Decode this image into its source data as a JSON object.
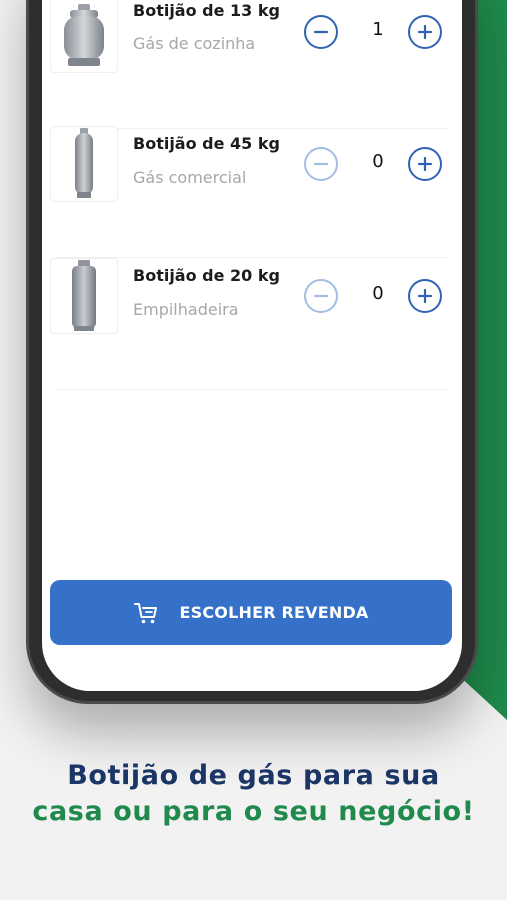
{
  "colors": {
    "brand_blue": "#3571c8",
    "brand_green": "#1f8a4c",
    "headline_navy": "#1c3567"
  },
  "products": [
    {
      "name": "Botijão de 13 kg",
      "description": "Gás de cozinha",
      "quantity": "1"
    },
    {
      "name": "Botijão de 45 kg",
      "description": "Gás comercial",
      "quantity": "0"
    },
    {
      "name": "Botijão de 20 kg",
      "description": "Empilhadeira",
      "quantity": "0"
    }
  ],
  "cta": {
    "label": "ESCOLHER REVENDA",
    "icon": "cart-icon"
  },
  "headline": {
    "line1": "Botijão de gás para sua",
    "line2": "casa ou para o seu negócio!"
  }
}
